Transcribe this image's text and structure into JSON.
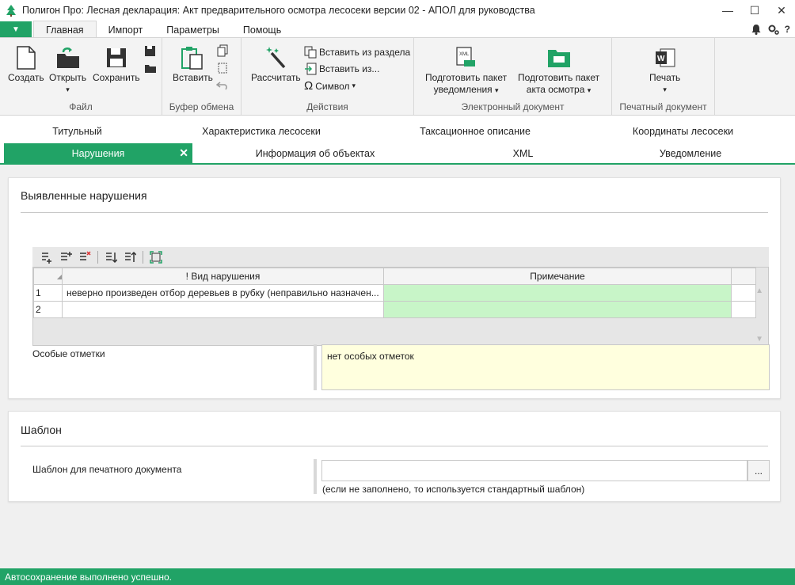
{
  "window": {
    "title": "Полигон Про: Лесная декларация: Акт предварительного осмотра лесосеки версии 02 - АПОЛ для руководства",
    "minimize": "—",
    "maximize": "☐",
    "close": "✕"
  },
  "ribbon_tabs": {
    "file_menu": "▼",
    "tabs": [
      "Главная",
      "Импорт",
      "Параметры",
      "Помощь"
    ],
    "active": "Главная",
    "right_icons": [
      "bell-icon",
      "settings-icon",
      "help-icon"
    ],
    "help_glyph": "?"
  },
  "ribbon": {
    "file_group": {
      "label": "Файл",
      "create": "Создать",
      "open": "Открыть",
      "open_arrow": "▾",
      "save": "Сохранить"
    },
    "clipboard_group": {
      "label": "Буфер обмена",
      "paste": "Вставить"
    },
    "actions_group": {
      "label": "Действия",
      "calculate": "Рассчитать",
      "insert_from_section": "Вставить из раздела",
      "insert_from": "Вставить из...",
      "symbol": "Символ",
      "symbol_arrow": "▾"
    },
    "edoc_group": {
      "label": "Электронный документ",
      "notice_pkg_line1": "Подготовить пакет",
      "notice_pkg_line2": "уведомления",
      "act_pkg_line1": "Подготовить пакет",
      "act_pkg_line2": "акта осмотра",
      "arrow": "▾"
    },
    "print_group": {
      "label": "Печатный документ",
      "print": "Печать",
      "arrow": "▾"
    }
  },
  "doc_tabs": {
    "row1": [
      "Титульный",
      "Характеристика лесосеки",
      "Таксационное описание",
      "Координаты лесосеки"
    ],
    "row2": [
      "Нарушения",
      "Информация об объектах",
      "XML",
      "Уведомление"
    ],
    "active": "Нарушения",
    "close_glyph": "✕"
  },
  "violations_panel": {
    "title": "Выявленные нарушения",
    "columns": [
      "! Вид нарушения",
      "Примечание"
    ],
    "rows": [
      {
        "num": "1",
        "type": "неверно произведен отбор деревьев в рубку (неправильно назначен...",
        "note": ""
      },
      {
        "num": "2",
        "type": "",
        "note": ""
      }
    ],
    "scroll_up": "▲",
    "scroll_down": "▼",
    "special_marks_label": "Особые отметки",
    "special_marks_value": "нет особых отметок"
  },
  "template_panel": {
    "title": "Шаблон",
    "field_label": "Шаблон для печатного документа",
    "field_value": "",
    "browse": "...",
    "hint": "(если не заполнено, то используется стандартный шаблон)"
  },
  "status": {
    "message": "Автосохранение выполнено успешно."
  },
  "colors": {
    "accent": "#21a366",
    "note_cell": "#c8f5c8",
    "notes_box": "#ffffde"
  }
}
